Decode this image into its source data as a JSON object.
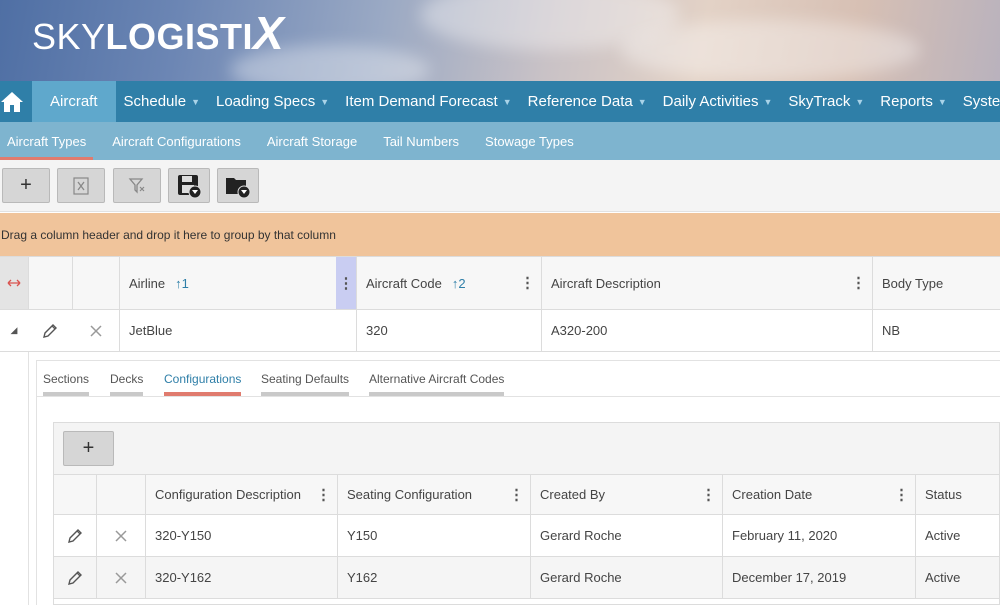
{
  "brand": {
    "logo_light": "SKY",
    "logo_bold": "LOGISTI",
    "logo_x": "X"
  },
  "mainnav": {
    "items": [
      {
        "label": "Aircraft",
        "active": true
      },
      {
        "label": "Schedule",
        "caret": "▼"
      },
      {
        "label": "Loading Specs",
        "caret": "▼"
      },
      {
        "label": "Item Demand Forecast",
        "caret": "▼"
      },
      {
        "label": "Reference Data",
        "caret": "▼"
      },
      {
        "label": "Daily Activities",
        "caret": "▼"
      },
      {
        "label": "SkyTrack",
        "caret": "▼"
      },
      {
        "label": "Reports",
        "caret": "▼"
      },
      {
        "label": "System/"
      }
    ]
  },
  "subnav": {
    "items": [
      {
        "label": "Aircraft Types"
      },
      {
        "label": "Aircraft Configurations"
      },
      {
        "label": "Aircraft Storage"
      },
      {
        "label": "Tail Numbers"
      },
      {
        "label": "Stowage Types"
      }
    ]
  },
  "toolbar": {
    "add_label": "+"
  },
  "group_panel": {
    "text": "Drag a column header and drop it here to group by that column"
  },
  "grid": {
    "columns": [
      {
        "label": "Airline",
        "sort": "↑1"
      },
      {
        "label": "Aircraft Code",
        "sort": "↑2"
      },
      {
        "label": "Aircraft Description"
      },
      {
        "label": "Body Type"
      }
    ],
    "row": {
      "expand": "◢",
      "airline": "JetBlue",
      "code": "320",
      "description": "A320-200",
      "body_type": "NB"
    }
  },
  "detail_tabs": [
    "Sections",
    "Decks",
    "Configurations",
    "Seating Defaults",
    "Alternative Aircraft Codes"
  ],
  "configurations": {
    "add_label": "+",
    "columns": [
      "Configuration Description",
      "Seating Configuration",
      "Created By",
      "Creation Date",
      "Status"
    ],
    "rows": [
      {
        "description": "320-Y150",
        "seating": "Y150",
        "created_by": "Gerard Roche",
        "date": "February 11, 2020",
        "status": "Active"
      },
      {
        "description": "320-Y162",
        "seating": "Y162",
        "created_by": "Gerard Roche",
        "date": "December 17, 2019",
        "status": "Active"
      }
    ]
  },
  "colors": {
    "nav": "#2f7fa8",
    "nav_active": "#5fa8cc",
    "subnav": "#7eb4cf",
    "accent": "#e07b6e",
    "group_panel": "#f0c49b"
  }
}
